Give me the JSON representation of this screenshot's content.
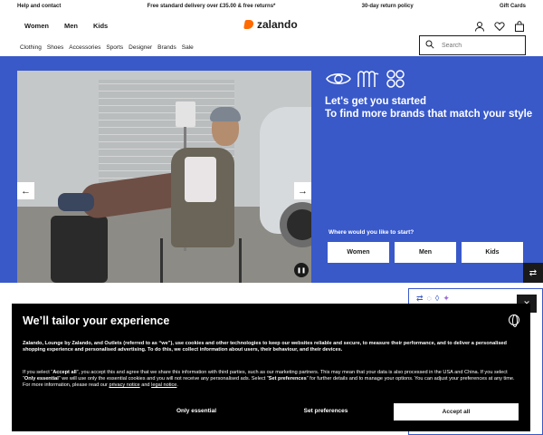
{
  "topbar": {
    "help": "Help and contact",
    "delivery": "Free standard delivery over £35.00 & free returns*",
    "returns": "30-day return policy",
    "gift": "Gift Cards"
  },
  "header": {
    "gender_tabs": [
      "Women",
      "Men",
      "Kids"
    ],
    "logo": "zalando"
  },
  "nav": {
    "items": [
      "Clothing",
      "Shoes",
      "Accessories",
      "Sports",
      "Designer",
      "Brands",
      "Sale"
    ],
    "search_placeholder": "Search"
  },
  "hero": {
    "title_line1": "Let's get you started",
    "title_line2": "To find more brands that match your style",
    "question": "Where would you like to start?",
    "buttons": [
      "Women",
      "Men",
      "Kids"
    ]
  },
  "cookie": {
    "title": "We’ll tailor your experience",
    "intro": "Zalando, Lounge by Zalando, and Outlets (referred to as “we”), use cookies and other technologies to keep our websites reliable and secure, to measure their performance, and to deliver a personalised shopping experience and personalised advertising. To do this, we collect information about users, their behaviour, and their devices.",
    "detail_a": "If you select “",
    "accept_all_bold": "Accept all",
    "detail_b": "”, you accept this and agree that we share this information with third parties, such as our marketing partners. This may mean that your data is also processed in the USA and China. If you select “",
    "only_essential_bold": "Only essential",
    "detail_c": "” we will use only the essential cookies and you will not receive any personalised ads. Select “",
    "set_prefs_bold": "Set preferences",
    "detail_d": "” for further details and to manage your options. You can adjust your preferences at any time. For more information, please read our ",
    "privacy_link": "privacy notice",
    "detail_e": " and ",
    "legal_link": "legal notice",
    "detail_f": ".",
    "btn_essential": "Only essential",
    "btn_prefs": "Set preferences",
    "btn_accept": "Accept all"
  },
  "colors": {
    "hero_blue": "#3959c9",
    "brand_orange": "#ff6900",
    "banner_black": "#000000"
  },
  "icons": [
    "user-icon",
    "heart-icon",
    "bag-icon",
    "search-icon",
    "arrow-left-icon",
    "arrow-right-icon",
    "pause-icon",
    "globe-icon",
    "brand-switch-icon",
    "close-icon"
  ]
}
